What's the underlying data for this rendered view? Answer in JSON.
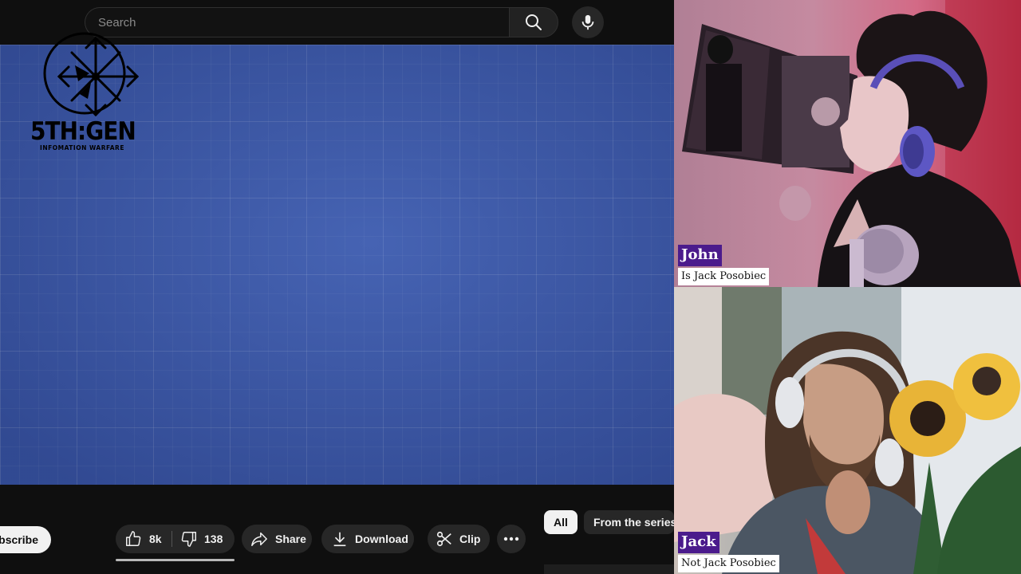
{
  "screen_share": {
    "search": {
      "placeholder": "Search"
    },
    "icons": {
      "search": "search-icon",
      "mic": "microphone-icon"
    },
    "video": {
      "logo_icon": "chaos-star-compass-logo",
      "logo_text": "5TH:GEN",
      "logo_subtext": "INFOMATION WARFARE",
      "background_color": "#3b58a8"
    },
    "actions": {
      "subscribe_label": "Subscribe",
      "like_count": "8k",
      "dislike_count": "138",
      "share_label": "Share",
      "download_label": "Download",
      "clip_label": "Clip",
      "icons": [
        "thumbs-up-icon",
        "thumbs-down-icon",
        "share-arrow-icon",
        "download-icon",
        "scissors-icon",
        "more-horizontal-icon"
      ]
    },
    "chips": {
      "all": "All",
      "series": "From the series"
    }
  },
  "webcams": [
    {
      "name": "John",
      "caption": "Is Jack Posobiec",
      "tag_color": "#4b1b8c"
    },
    {
      "name": "Jack",
      "caption": "Not Jack Posobiec",
      "tag_color": "#4b1b8c"
    }
  ]
}
